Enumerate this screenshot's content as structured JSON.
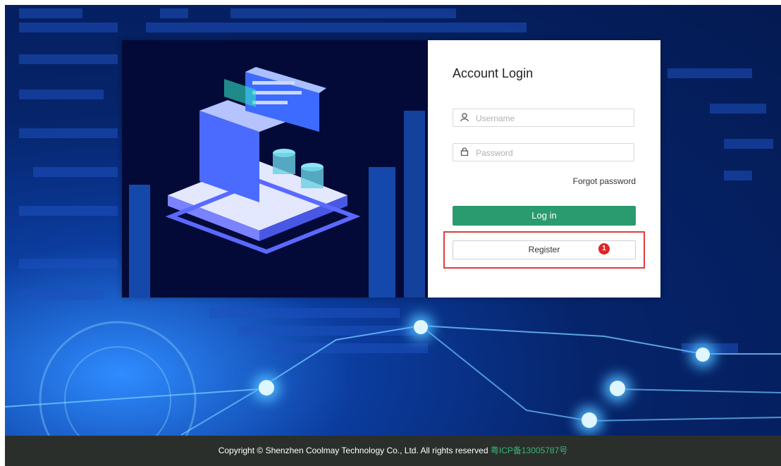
{
  "login_panel": {
    "title": "Account Login",
    "username_placeholder": "Username",
    "password_placeholder": "Password",
    "forgot_password": "Forgot password",
    "login_button": "Log in",
    "register_button": "Register",
    "register_badge": "1"
  },
  "footer": {
    "copyright": "Copyright © Shenzhen Coolmay Technology Co., Ltd. All rights reserved",
    "icp": "粤ICP备13005787号"
  },
  "colors": {
    "login_button": "#2a9b6e",
    "highlight_border": "#e23b3b",
    "badge": "#e02424",
    "icp_link": "#39b37a"
  },
  "icons": {
    "username": "user-icon",
    "password": "lock-icon"
  }
}
